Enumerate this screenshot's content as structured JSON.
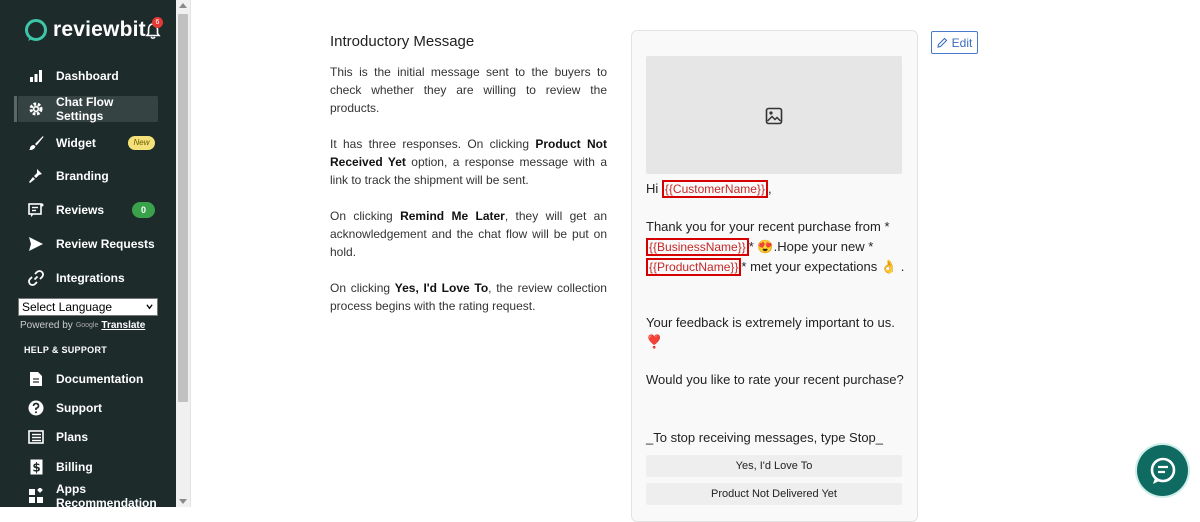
{
  "brand": {
    "name": "reviewbit",
    "notification_count": "6"
  },
  "sidebar": {
    "nav": [
      {
        "label": "Dashboard",
        "icon": "bar-chart-icon"
      },
      {
        "label": "Chat Flow Settings",
        "icon": "gear-icon",
        "active": true
      },
      {
        "label": "Widget",
        "icon": "brush-icon",
        "badge": "New"
      },
      {
        "label": "Branding",
        "icon": "stamp-icon"
      },
      {
        "label": "Reviews",
        "icon": "review-icon",
        "badge": "0"
      },
      {
        "label": "Review Requests",
        "icon": "send-icon"
      },
      {
        "label": "Integrations",
        "icon": "link-icon"
      }
    ],
    "language_select": "Select Language",
    "powered_by": "Powered by",
    "powered_google": "Google",
    "translate_link": "Translate",
    "section_help": "HELP & SUPPORT",
    "support_nav": [
      {
        "label": "Documentation",
        "icon": "document-icon"
      },
      {
        "label": "Support",
        "icon": "question-icon"
      },
      {
        "label": "Plans",
        "icon": "list-icon"
      },
      {
        "label": "Billing",
        "icon": "dollar-icon"
      },
      {
        "label": "Apps Recommendation",
        "icon": "apps-icon"
      }
    ]
  },
  "intro": {
    "title": "Introductory Message",
    "p1": "This is the initial message sent to the buyers to check whether they are willing to review the products.",
    "p2_a": "It has three responses. On clicking ",
    "p2_b": "Product Not Received Yet",
    "p2_c": " option, a response message with a link to track the shipment will be sent.",
    "p3_a": "On clicking ",
    "p3_b": "Remind Me Later",
    "p3_c": ", they will get an acknowledgement and the chat flow will be put on hold.",
    "p4_a": "On clicking ",
    "p4_b": "Yes, I'd Love To",
    "p4_c": ", the review collection process begins with the rating request."
  },
  "preview": {
    "greeting_prefix": "Hi ",
    "customer_token": "{{CustomerName}}",
    "greeting_suffix": ",",
    "thanks_a": "Thank you for your recent purchase from *",
    "business_token": "{{BusinessName}}",
    "thanks_b": "* 😍.Hope your new *",
    "product_token": "{{ProductName}}",
    "thanks_c": "* met your expectations",
    "thanks_emoji": "👌 .",
    "feedback": "Your feedback is extremely important to us. ❣️",
    "question": "Would you like to rate your recent purchase?",
    "stop": "_To stop receiving messages, type Stop_",
    "replies": [
      "Yes, I'd Love To",
      "Product Not Delivered Yet"
    ]
  },
  "edit_label": "Edit",
  "colors": {
    "sidebar_bg": "#1e2b2b",
    "accent_teal": "#0f6b62",
    "token_red": "#d50000",
    "edit_blue": "#3c6dbd"
  }
}
